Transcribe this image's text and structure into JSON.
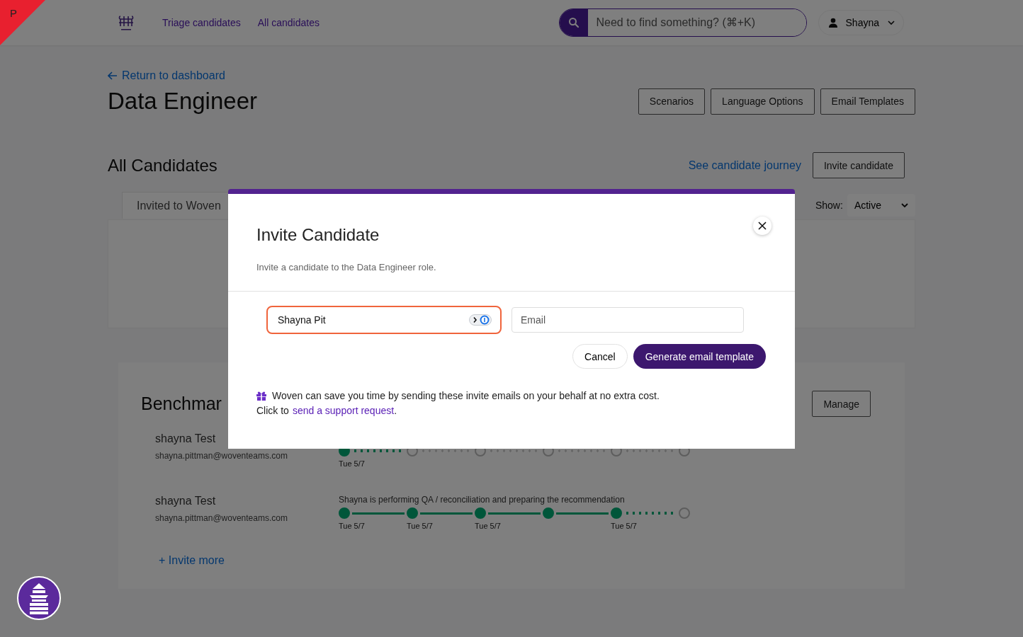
{
  "corner_badge": {
    "label": "P"
  },
  "nav": {
    "links": [
      {
        "label": "Triage candidates"
      },
      {
        "label": "All candidates"
      }
    ],
    "search": {
      "placeholder": "Need to find something? (⌘+K)"
    },
    "user": {
      "name": "Shayna"
    }
  },
  "back_link": {
    "label": "Return to dashboard"
  },
  "page_title": "Data Engineer",
  "header_buttons": [
    "Scenarios",
    "Language Options",
    "Email Templates"
  ],
  "section": {
    "title": "All Candidates",
    "journey_link": "See candidate journey",
    "invite_button": "Invite candidate"
  },
  "tabs": [
    {
      "label": "Invited to Woven",
      "selected": true
    }
  ],
  "filter": {
    "label": "Show:",
    "value": "Active"
  },
  "benchmark": {
    "title": "Benchmar",
    "manage_button": "Manage",
    "invite_more": "+ Invite more",
    "candidates": [
      {
        "name": "shayna Test",
        "email": "shayna.pittman@woventeams.com",
        "steps": [
          {
            "done": true,
            "date": "Tue 5/7"
          },
          {
            "done": false
          },
          {
            "done": false
          },
          {
            "done": false
          },
          {
            "done": false
          },
          {
            "done": false
          }
        ]
      },
      {
        "name": "shayna Test",
        "email": "shayna.pittman@woventeams.com",
        "status": "Shayna is performing QA / reconciliation and preparing the recommendation",
        "steps": [
          {
            "done": true,
            "date": "Tue 5/7"
          },
          {
            "done": true,
            "date": "Tue 5/7"
          },
          {
            "done": true,
            "date": "Tue 5/7"
          },
          {
            "done": true
          },
          {
            "done": true,
            "date": "Tue 5/7"
          },
          {
            "done": false
          }
        ]
      }
    ]
  },
  "modal": {
    "title": "Invite Candidate",
    "subtitle": "Invite a candidate to the Data Engineer role.",
    "name_field": {
      "value": "Shayna Pit",
      "focused": true
    },
    "email_field": {
      "placeholder": "Email"
    },
    "cancel_button": "Cancel",
    "submit_button": "Generate email template",
    "note": "Woven can save you time by sending these invite emails on your behalf at no extra cost.",
    "note_prefix": "Click to",
    "note_link": "send a support request",
    "note_suffix": "."
  }
}
